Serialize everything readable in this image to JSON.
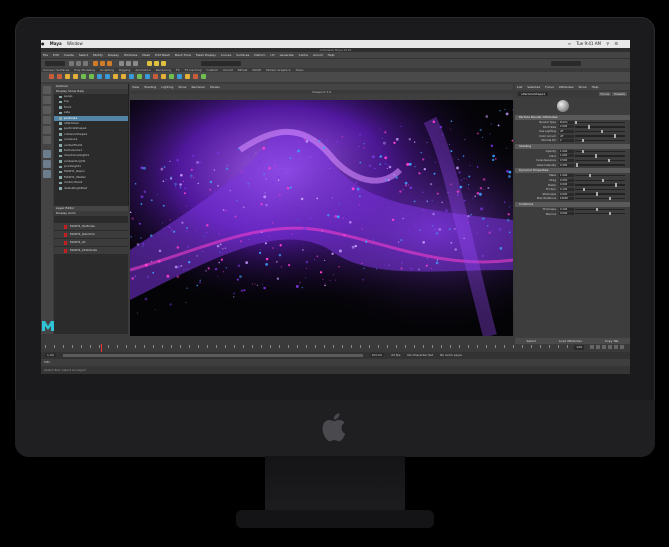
{
  "mac_menubar": {
    "app": "Maya",
    "window_menu": "Window",
    "clock": "Tue 9:41 AM"
  },
  "app_title": "Autodesk Maya 2019",
  "maya_menu": [
    "File",
    "Edit",
    "Create",
    "Select",
    "Modify",
    "Display",
    "Windows",
    "Mesh",
    "Edit Mesh",
    "Mesh Tools",
    "Mesh Display",
    "Curves",
    "Surfaces",
    "Deform",
    "UV",
    "Generate",
    "Cache",
    "Arnold",
    "Help"
  ],
  "shelf_tabs": [
    "Curves / Surfaces",
    "Poly Modeling",
    "Sculpting",
    "Rigging",
    "Animation",
    "Rendering",
    "FX",
    "FX Caching",
    "Custom",
    "Arnold",
    "Bifrost",
    "MASH",
    "Motion Graphics",
    "XGen"
  ],
  "outliner": {
    "title": "Outliner",
    "menu": "Display  Show  Help",
    "items": [
      "persp",
      "top",
      "front",
      "side",
      "particle1",
      "nParticle1",
      "particleShape1",
      "collisionShape1",
      "nucleus1",
      "vortexField1",
      "turbulence1",
      "directionalLight1",
      "ambientLight1",
      "pointLight1",
      "MASH1_Repro",
      "MASH1_Waiter",
      "motionTrail1",
      "defaultLightSet"
    ],
    "selected_index": 4
  },
  "layer_editor": {
    "title": "Layer Editor",
    "tabs": "Display  Anim",
    "layers": [
      "MASH1_Particles",
      "MASH1_Random",
      "MASH1_ID",
      "MASH1_Distribute"
    ]
  },
  "viewport": {
    "panel_title": "Viewport 2.0",
    "menu": [
      "View",
      "Shading",
      "Lighting",
      "Show",
      "Renderer",
      "Panels"
    ]
  },
  "attribute_editor": {
    "tabs": [
      "List",
      "Selected",
      "Focus",
      "Attributes",
      "Show",
      "Help"
    ],
    "node_label": "nParticleShape1",
    "buttons": [
      "Focus",
      "Presets",
      "Show",
      "Hide"
    ],
    "sections": [
      {
        "title": "Particle Render Attributes",
        "rows": [
          [
            "Render Type",
            "Points"
          ],
          [
            "Point Size",
            "2.000"
          ],
          [
            "Use Lighting",
            "off"
          ],
          [
            "Color Accum",
            "off"
          ],
          [
            "Normal Dir",
            "2"
          ]
        ]
      },
      {
        "title": "Shading",
        "rows": [
          [
            "Opacity",
            "1.000"
          ],
          [
            "Color",
            "1.000"
          ],
          [
            "Incandescence",
            "0.500"
          ],
          [
            "Glow Intensity",
            "0.300"
          ]
        ]
      },
      {
        "title": "Dynamic Properties",
        "rows": [
          [
            "Mass",
            "1.000"
          ],
          [
            "Drag",
            "0.050"
          ],
          [
            "Damp",
            "0.000"
          ],
          [
            "Friction",
            "0.100"
          ],
          [
            "Stickiness",
            "0.000"
          ],
          [
            "Max Iterations",
            "10000"
          ]
        ]
      },
      {
        "title": "Collisions",
        "rows": [
          [
            "Thickness",
            "0.100"
          ],
          [
            "Bounce",
            "0.000"
          ]
        ]
      }
    ],
    "bottom_buttons": [
      "Select",
      "Load Attributes",
      "Copy Tab"
    ]
  },
  "timeline": {
    "current_frame": "120",
    "start": "1",
    "end": "200"
  },
  "range_slider": {
    "start": "1.00",
    "end": "200.00",
    "fps": "24 fps",
    "character_set": "No Character Set",
    "anim_layer": "No Anim Layer"
  },
  "command_line": "MEL",
  "help_line": "Select Tool: select an object",
  "colors": {
    "selection": "#5285a6",
    "viewport_bg": "#040406",
    "particle_main": "#7b35e0",
    "particle_accent": "#ff3fd0",
    "particle_cool": "#3fa0ff"
  }
}
